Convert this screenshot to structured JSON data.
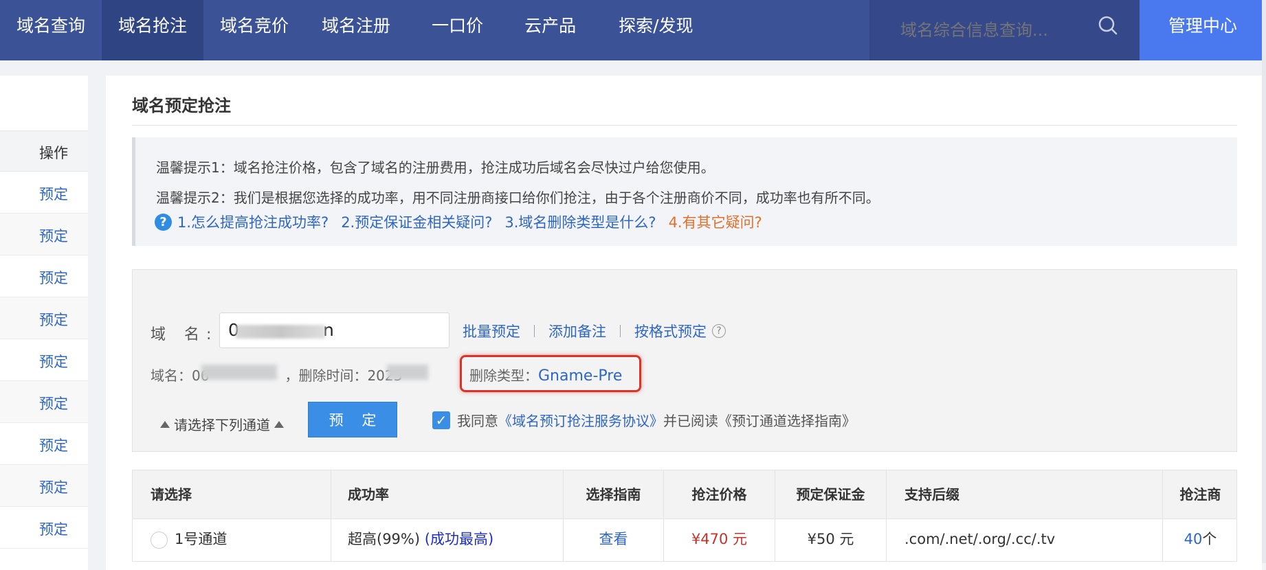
{
  "nav": {
    "items": [
      "域名查询",
      "域名抢注",
      "域名竞价",
      "域名注册",
      "一口价",
      "云产品",
      "探索/发现"
    ],
    "search_placeholder": "域名综合信息查询...",
    "admin_label": "管理中心"
  },
  "left_table": {
    "header": "操作",
    "rows": [
      "预定",
      "预定",
      "预定",
      "预定",
      "预定",
      "预定",
      "预定",
      "预定",
      "预定"
    ]
  },
  "page": {
    "title": "域名预定抢注",
    "tips": [
      "温馨提示1：域名抢注价格，包含了域名的注册费用，抢注成功后域名会尽快过户给您使用。",
      "温馨提示2：我们是根据您选择的成功率，用不同注册商接口给你们抢注，由于各个注册商价不同，成功率也有所不同。"
    ],
    "faq": [
      "1.怎么提高抢注成功率?",
      "2.预定保证金相关疑问?",
      "3.域名删除类型是什么?",
      "4.有其它疑问?"
    ]
  },
  "form": {
    "domain_label": "域 名:",
    "domain_value_start": "0",
    "domain_value_end": "n",
    "links": [
      "批量预定",
      "添加备注",
      "按格式预定"
    ],
    "info_domain_prefix": "域名：06",
    "info_delete_time": "，删除时间：2023",
    "delete_type_label": "删除类型：",
    "delete_type_value": "Gname-Pre",
    "channel_select": "请选择下列通道",
    "reserve_button": "预 定",
    "agree_prefix": "我同意",
    "agree_link": "《域名预订抢注服务协议》",
    "agree_suffix": "并已阅读《预订通道选择指南》"
  },
  "channel_table": {
    "headers": [
      "请选择",
      "成功率",
      "选择指南",
      "抢注价格",
      "预定保证金",
      "支持后缀",
      "抢注商"
    ],
    "rows": [
      {
        "name": "1号通道",
        "rate": "超高(99%)",
        "rate_note": "(成功最高)",
        "guide": "查看",
        "price": "¥470 元",
        "deposit": "¥50 元",
        "suffixes": ".com/.net/.org/.cc/.tv",
        "registrar_count": "40",
        "registrar_unit": "个"
      }
    ]
  }
}
